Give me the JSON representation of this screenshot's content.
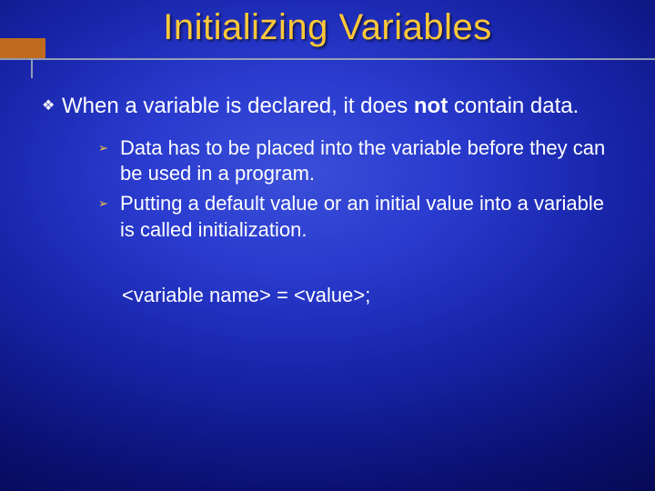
{
  "slide": {
    "title": "Initializing Variables",
    "bullet1": {
      "pre": "When a variable is declared, it does ",
      "bold": "not",
      "post": " contain data."
    },
    "sub": {
      "a": "Data has to be placed into the variable before they can be used in a program.",
      "b": "Putting a default value or an initial value into a variable is called initialization."
    },
    "syntax": "<variable name> = <value>;"
  },
  "glyphs": {
    "diamond": "❖",
    "arrow": "➢"
  }
}
